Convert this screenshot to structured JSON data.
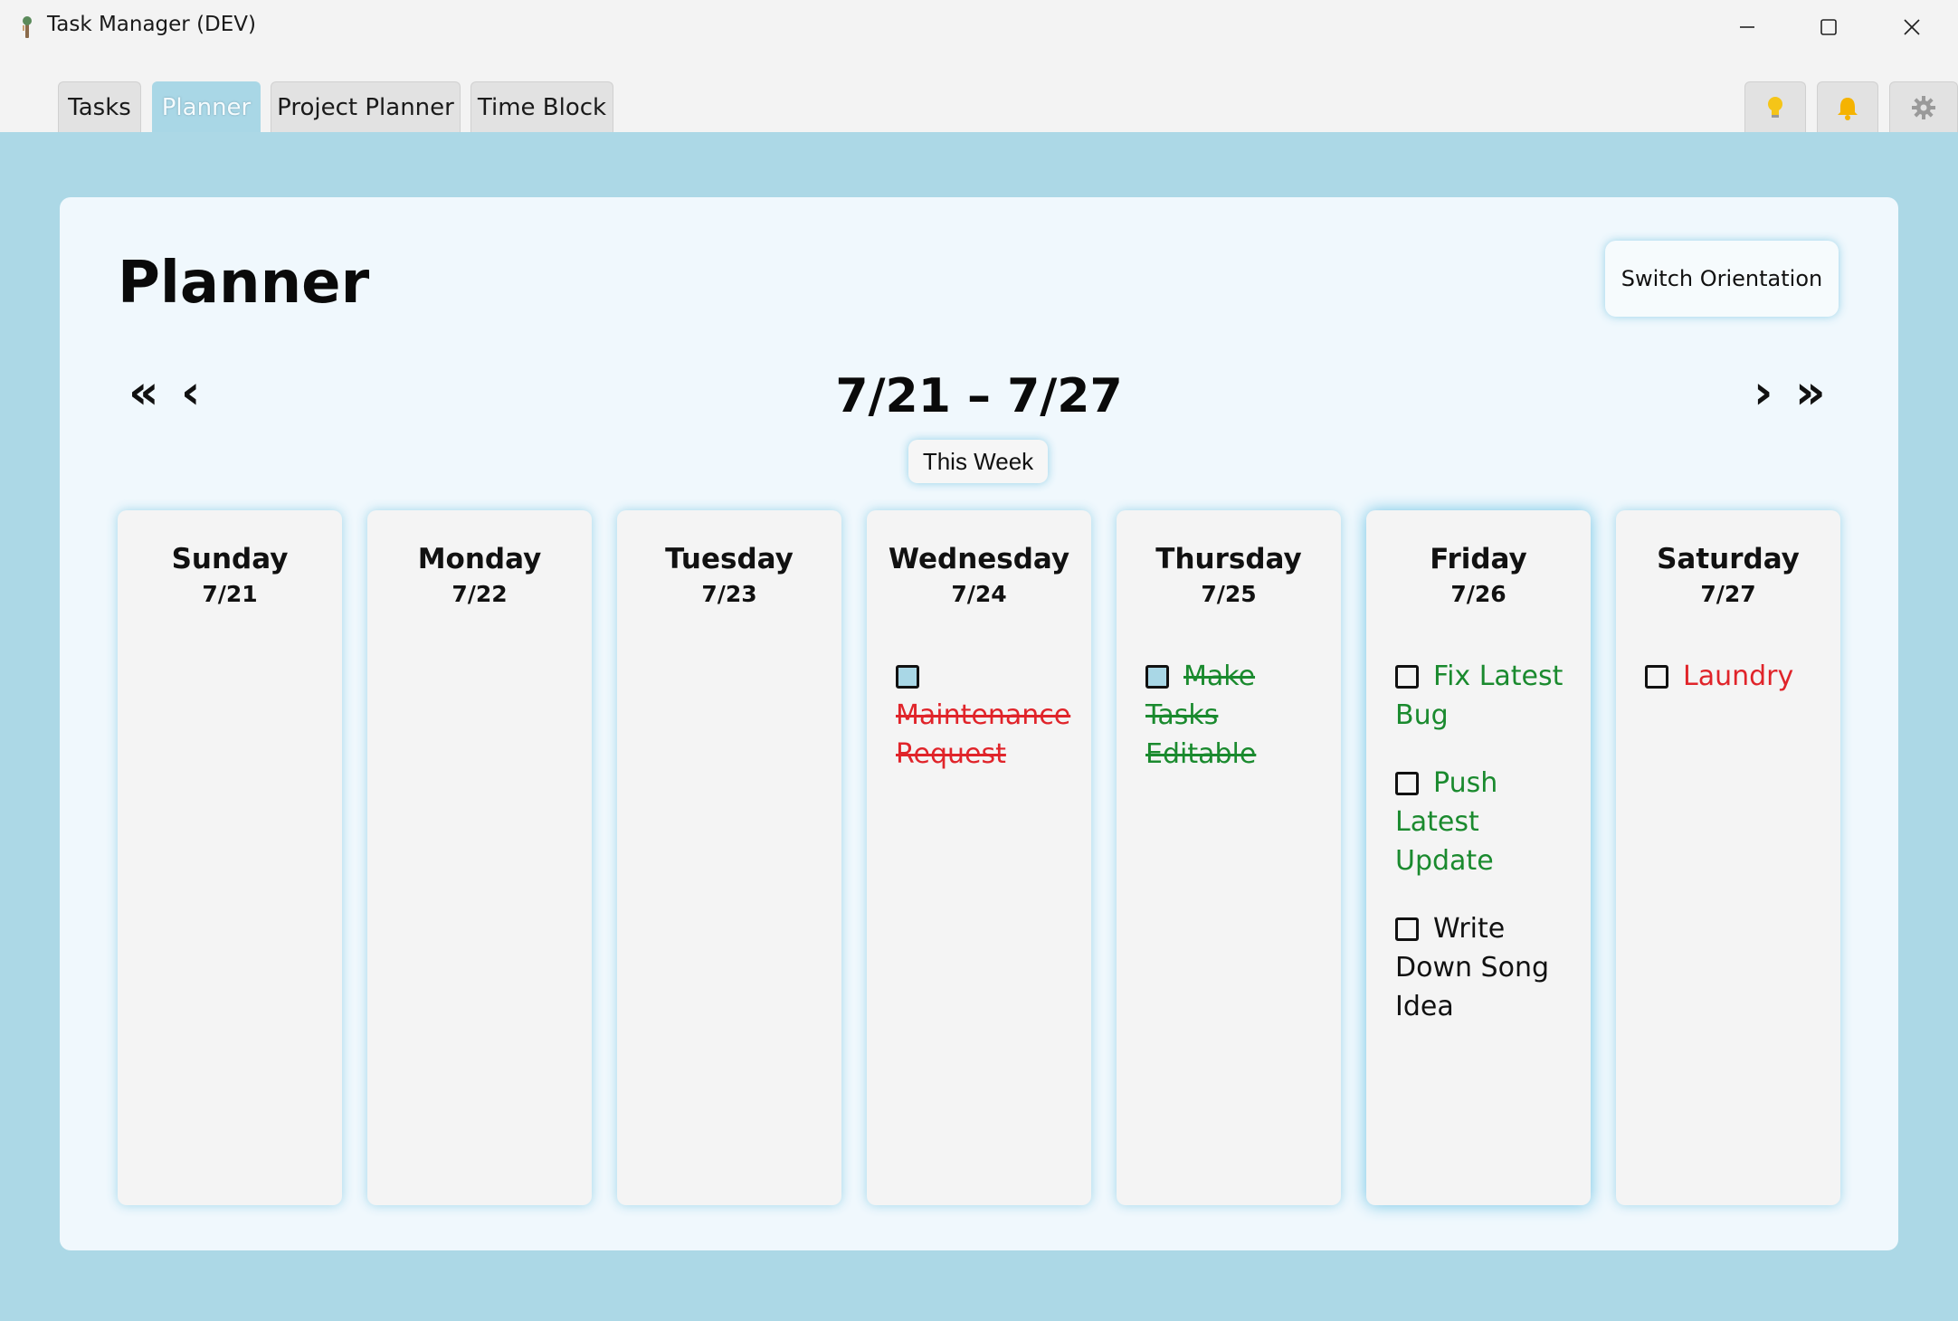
{
  "window": {
    "title": "Task Manager (DEV)"
  },
  "tabs": [
    {
      "label": "Tasks",
      "active": false
    },
    {
      "label": "Planner",
      "active": true
    },
    {
      "label": "Project Planner",
      "active": false
    },
    {
      "label": "Time Block",
      "active": false
    }
  ],
  "toolbar_icons": [
    "lightbulb-icon",
    "bell-icon",
    "gear-icon"
  ],
  "colors": {
    "accent": "#acd8e6",
    "done_green": "#1a8a2e",
    "overdue_red": "#e0242a"
  },
  "planner": {
    "title": "Planner",
    "switch_label": "Switch Orientation",
    "range": "7/21 – 7/27",
    "this_week_label": "This Week",
    "nav": {
      "prev_far": "«",
      "prev": "‹",
      "next": "›",
      "next_far": "»"
    },
    "days": [
      {
        "name": "Sunday",
        "date": "7/21",
        "tasks": []
      },
      {
        "name": "Monday",
        "date": "7/22",
        "tasks": []
      },
      {
        "name": "Tuesday",
        "date": "7/23",
        "tasks": []
      },
      {
        "name": "Wednesday",
        "date": "7/24",
        "tasks": [
          {
            "text": "Maintenance Request",
            "color": "red",
            "completed": true,
            "checkbox_filled": true
          }
        ]
      },
      {
        "name": "Thursday",
        "date": "7/25",
        "tasks": [
          {
            "text": "Make Tasks Editable",
            "color": "green",
            "completed": true,
            "checkbox_filled": true
          }
        ]
      },
      {
        "name": "Friday",
        "date": "7/26",
        "today": true,
        "tasks": [
          {
            "text": "Fix Latest Bug",
            "color": "green",
            "completed": false,
            "checkbox_filled": false
          },
          {
            "text": "Push Latest Update",
            "color": "green",
            "completed": false,
            "checkbox_filled": false
          },
          {
            "text": "Write Down Song Idea",
            "color": "black",
            "completed": false,
            "checkbox_filled": false
          }
        ]
      },
      {
        "name": "Saturday",
        "date": "7/27",
        "tasks": [
          {
            "text": "Laundry",
            "color": "red",
            "completed": false,
            "checkbox_filled": false
          }
        ]
      }
    ]
  }
}
